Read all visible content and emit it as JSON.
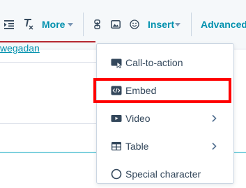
{
  "toolbar": {
    "more_label": "More",
    "insert_label": "Insert",
    "advanced_label": "Advanced"
  },
  "document": {
    "link_text": "wegadan"
  },
  "insert_menu": {
    "items": [
      {
        "label": "Call-to-action",
        "icon": "cta-icon",
        "has_submenu": false
      },
      {
        "label": "Embed",
        "icon": "embed-icon",
        "has_submenu": false,
        "highlighted": true
      },
      {
        "label": "Video",
        "icon": "video-icon",
        "has_submenu": true
      },
      {
        "label": "Table",
        "icon": "table-icon",
        "has_submenu": true
      },
      {
        "label": "Special character",
        "icon": "special-character-icon",
        "has_submenu": false
      }
    ]
  },
  "colors": {
    "accent": "#0091ae",
    "text": "#33475b",
    "highlight_box": "#ff0000"
  }
}
